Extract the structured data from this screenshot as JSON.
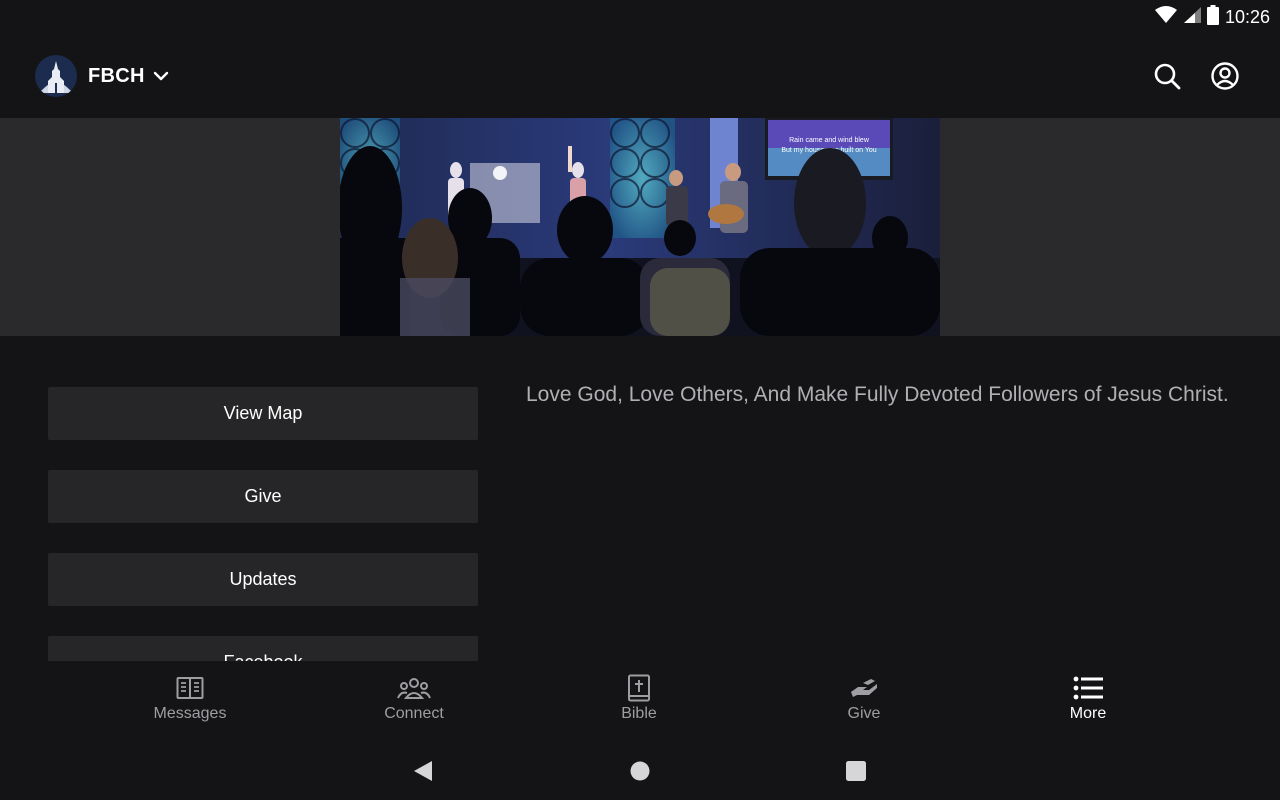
{
  "status_bar": {
    "time": "10:26",
    "icons": [
      "wifi-icon",
      "cell-signal-icon",
      "battery-icon"
    ]
  },
  "header": {
    "org_name": "FBCH",
    "logo": "church-steeple-logo",
    "actions": [
      "search-icon",
      "account-icon"
    ]
  },
  "hero": {
    "lyrics_line1": "Rain came and wind blew",
    "lyrics_line2": "But my house was built on You"
  },
  "buttons": [
    {
      "label": "View Map"
    },
    {
      "label": "Give"
    },
    {
      "label": "Updates"
    },
    {
      "label": "Facebook"
    }
  ],
  "mission": "Love God, Love Others, And Make Fully Devoted Followers of Jesus Christ.",
  "bottom_nav": {
    "items": [
      {
        "label": "Messages",
        "icon": "book-open-icon",
        "active": false
      },
      {
        "label": "Connect",
        "icon": "people-group-icon",
        "active": false
      },
      {
        "label": "Bible",
        "icon": "bible-icon",
        "active": false
      },
      {
        "label": "Give",
        "icon": "giving-hand-icon",
        "active": false
      },
      {
        "label": "More",
        "icon": "list-icon",
        "active": true
      }
    ]
  },
  "colors": {
    "background": "#141416",
    "button_bg": "#262628",
    "hero_band": "#2a2a2c",
    "muted_text": "#9e9ea2",
    "logo_bg": "#1c2c4e"
  }
}
